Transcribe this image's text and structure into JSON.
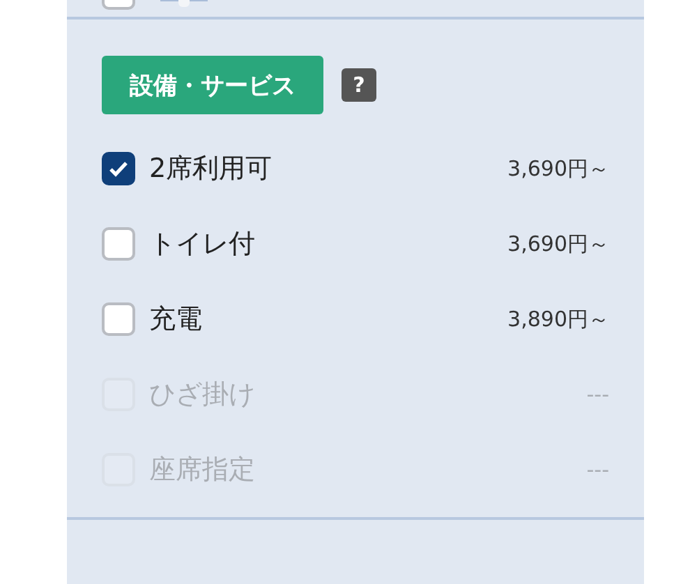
{
  "top_row": {
    "checked": false
  },
  "section": {
    "title": "設備・サービス",
    "help": "?"
  },
  "options": [
    {
      "label": "2席利用可",
      "price": "3,690円～",
      "checked": true,
      "disabled": false
    },
    {
      "label": "トイレ付",
      "price": "3,690円～",
      "checked": false,
      "disabled": false
    },
    {
      "label": "充電",
      "price": "3,890円～",
      "checked": false,
      "disabled": false
    },
    {
      "label": "ひざ掛け",
      "price": "---",
      "checked": false,
      "disabled": true
    },
    {
      "label": "座席指定",
      "price": "---",
      "checked": false,
      "disabled": true
    }
  ]
}
